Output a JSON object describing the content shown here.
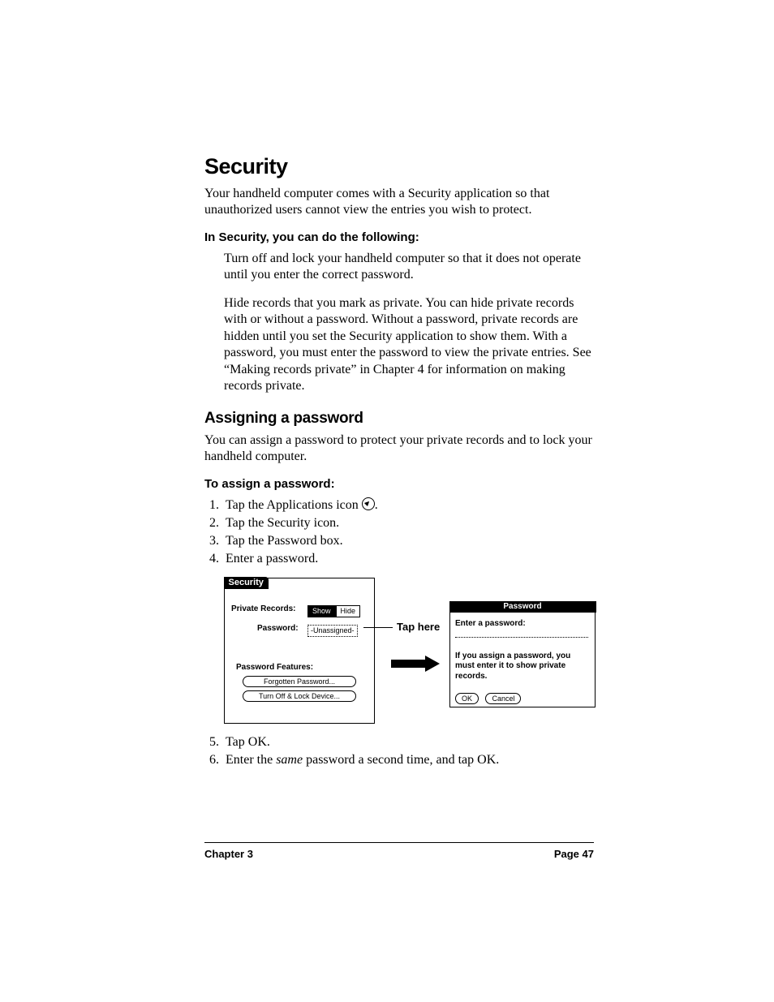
{
  "h1": "Security",
  "intro": "Your handheld computer comes with a Security application so that unauthorized users cannot view the entries you wish to protect.",
  "sub1_title": "In Security, you can do the following:",
  "sub1_p1": "Turn off and lock your handheld computer so that it does not operate until you enter the correct password.",
  "sub1_p2": "Hide records that you mark as private. You can hide private records with or without a password. Without a password, private records are hidden until you set the Security application to show them. With a password, you must enter the password to view the private entries. See “Making records private” in Chapter 4 for information on making records private.",
  "h2": "Assigning a password",
  "h2_intro": "You can assign a password to protect your private records and to lock your handheld computer.",
  "sub2_title": "To assign a password:",
  "steps": {
    "s1a": "Tap the Applications icon ",
    "s1b": ".",
    "s2": "Tap the Security icon.",
    "s3": "Tap the Password box.",
    "s4": "Enter a password.",
    "s5": "Tap OK.",
    "s6a": "Enter the ",
    "s6i": "same",
    "s6b": " password a second time, and tap OK."
  },
  "fig": {
    "sec_tab": "Security",
    "priv_label": "Private Records:",
    "show": "Show",
    "hide": "Hide",
    "pw_label": "Password:",
    "unassigned": "-Unassigned-",
    "pf_label": "Password Features:",
    "btn_forgot": "Forgotten Password...",
    "btn_lock": "Turn Off & Lock Device...",
    "callout": "Tap here",
    "pw_title": "Password",
    "pw_prompt": "Enter a password:",
    "pw_note": "If you assign a password, you must enter it to show private records.",
    "ok": "OK",
    "cancel": "Cancel"
  },
  "footer": {
    "left": "Chapter 3",
    "right": "Page 47"
  }
}
